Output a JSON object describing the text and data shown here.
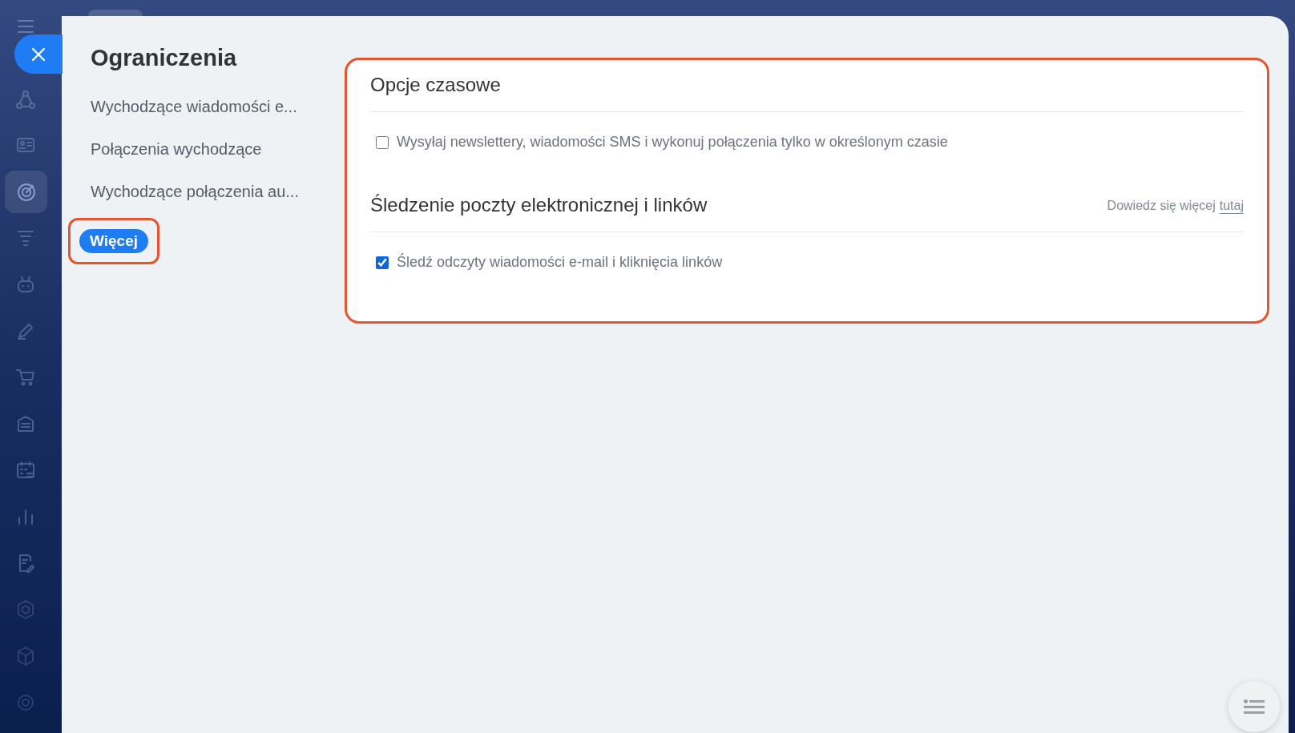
{
  "panel": {
    "title": "Ograniczenia"
  },
  "menu": {
    "items": [
      {
        "label": "Wychodzące wiadomości e..."
      },
      {
        "label": "Połączenia wychodzące"
      },
      {
        "label": "Wychodzące połączenia au..."
      }
    ],
    "more_button": "Więcej"
  },
  "sections": [
    {
      "title": "Opcje czasowe",
      "options": [
        {
          "label": "Wysyłaj newslettery, wiadomości SMS i wykonuj połączenia tylko w określonym czasie",
          "checked": false
        }
      ]
    },
    {
      "title": "Śledzenie poczty elektronicznej i linków",
      "help_text": "Dowiedz się więcej",
      "help_link": "tutaj",
      "options": [
        {
          "label": "Śledź odczyty wiadomości e-mail i kliknięcia linków",
          "checked": true
        }
      ]
    }
  ]
}
